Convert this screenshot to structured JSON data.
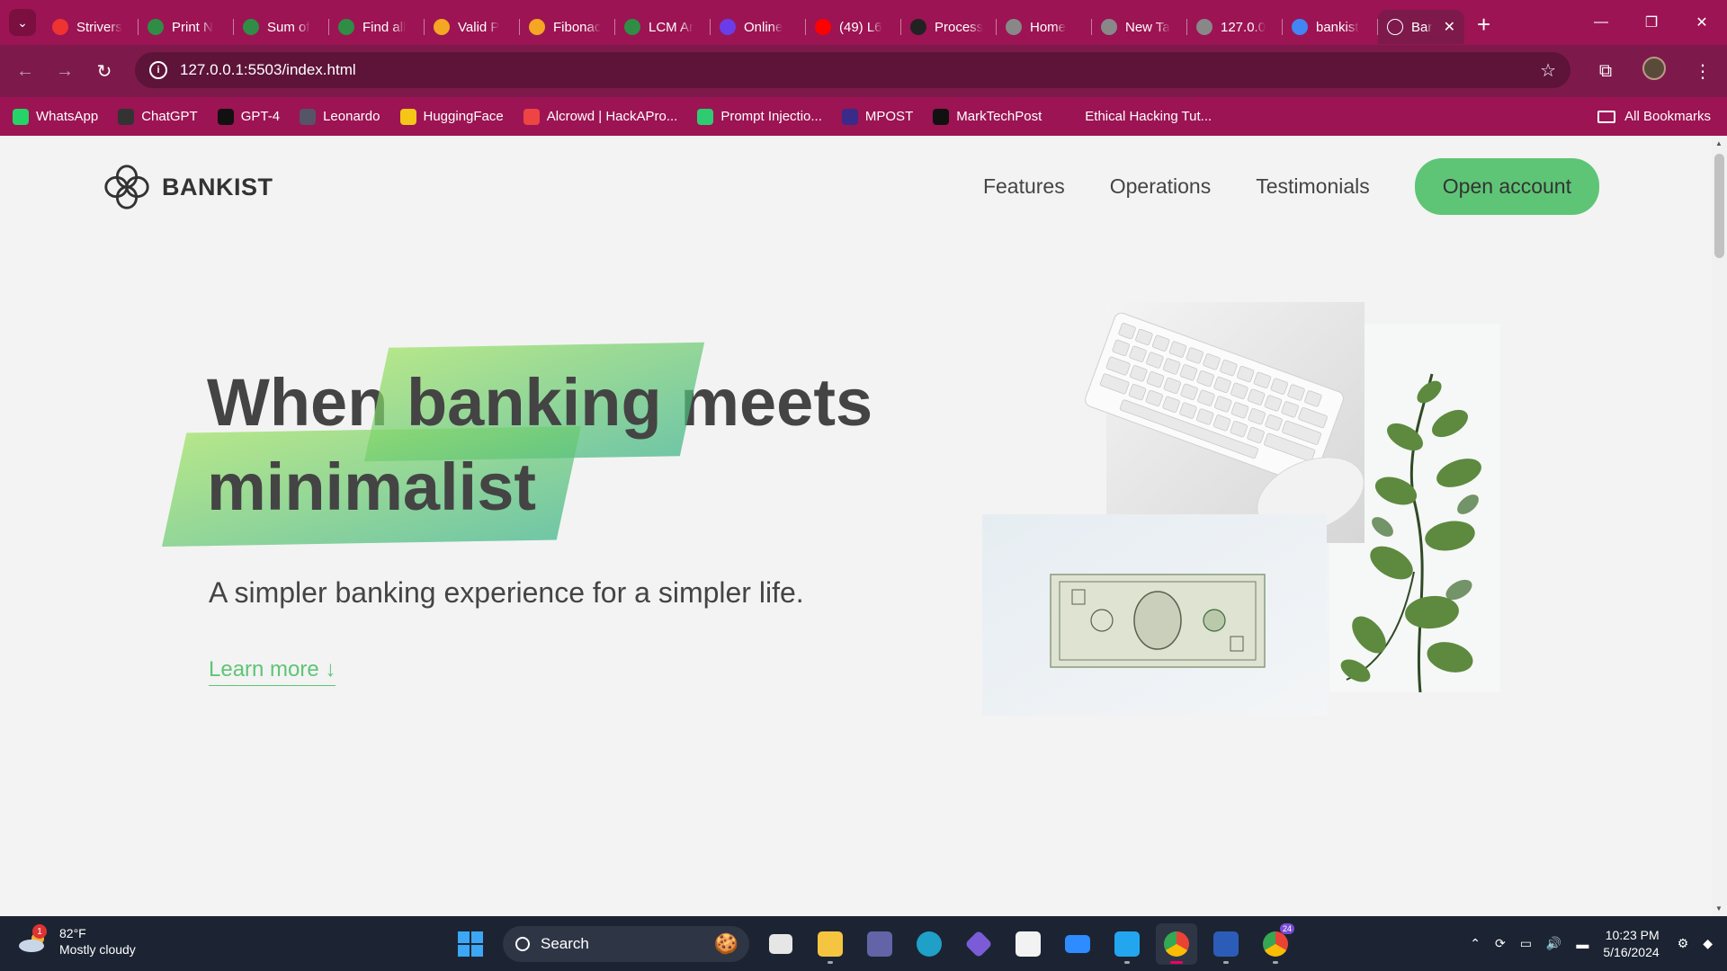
{
  "browser": {
    "tabs": [
      {
        "title": "Strivers",
        "icon": "tuf-icon",
        "color": "#e33"
      },
      {
        "title": "Print N",
        "icon": "gfg-icon",
        "color": "#2f8d46"
      },
      {
        "title": "Sum of",
        "icon": "gfg-icon",
        "color": "#2f8d46"
      },
      {
        "title": "Find all",
        "icon": "gfg-icon",
        "color": "#2f8d46"
      },
      {
        "title": "Valid P",
        "icon": "leetcode-icon",
        "color": "#f5a623"
      },
      {
        "title": "Fibonac",
        "icon": "leetcode-icon",
        "color": "#f5a623"
      },
      {
        "title": "LCM Ar",
        "icon": "gfg-icon",
        "color": "#2f8d46"
      },
      {
        "title": "Online",
        "icon": "online-icon",
        "color": "#6a3de8"
      },
      {
        "title": "(49) L6",
        "icon": "youtube-icon",
        "color": "#ff0000"
      },
      {
        "title": "Process",
        "icon": "github-icon",
        "color": "#222"
      },
      {
        "title": "Home",
        "icon": "globe-icon",
        "color": "#888"
      },
      {
        "title": "New Ta",
        "icon": "chrome-icon",
        "color": "#888"
      },
      {
        "title": "127.0.0",
        "icon": "globe-icon",
        "color": "#888"
      },
      {
        "title": "bankist",
        "icon": "google-icon",
        "color": "#4285f4"
      }
    ],
    "active_tab": {
      "title": "Bar",
      "close": "✕"
    },
    "new_tab": "+",
    "url": "127.0.0.1:5503/index.html",
    "bookmarks": [
      {
        "label": "WhatsApp",
        "color": "#25d366",
        "icon": "whatsapp-icon"
      },
      {
        "label": "ChatGPT",
        "color": "#333",
        "icon": "chatgpt-icon"
      },
      {
        "label": "GPT-4",
        "color": "#111",
        "icon": "gpt4-icon"
      },
      {
        "label": "Leonardo",
        "color": "#556",
        "icon": "leonardo-icon"
      },
      {
        "label": "HuggingFace",
        "color": "#f5c518",
        "icon": "huggingface-icon"
      },
      {
        "label": "Alcrowd | HackAPro...",
        "color": "#e44",
        "icon": "alcrowd-icon"
      },
      {
        "label": "Prompt Injectio...",
        "color": "#2ecc71",
        "icon": "prompt-injection-icon"
      },
      {
        "label": "MPOST",
        "color": "#3a2a8a",
        "icon": "mpost-icon"
      },
      {
        "label": "MarkTechPost",
        "color": "#111",
        "icon": "marktechpost-icon"
      },
      {
        "label": "Ethical Hacking Tut...",
        "color": "#9c1453",
        "icon": "blank-icon"
      }
    ],
    "all_bookmarks": "All Bookmarks"
  },
  "site": {
    "logo_text": "BANKIST",
    "nav": {
      "features": "Features",
      "operations": "Operations",
      "testimonials": "Testimonials",
      "cta": "Open account"
    },
    "hero": {
      "title_word1": "When",
      "title_highlight1": "banking",
      "title_word2": "meets",
      "title_highlight2": "minimalist",
      "subtitle": "A simpler banking experience for a simpler life.",
      "learn_more": "Learn more ↓"
    },
    "colors": {
      "primary": "#5ec576",
      "text": "#444444",
      "background": "#f3f3f3"
    }
  },
  "taskbar": {
    "weather_temp": "82°F",
    "weather_desc": "Mostly cloudy",
    "weather_badge": "1",
    "search_label": "Search",
    "time": "10:23 PM",
    "date": "5/16/2024",
    "chrome_badge": "24"
  }
}
